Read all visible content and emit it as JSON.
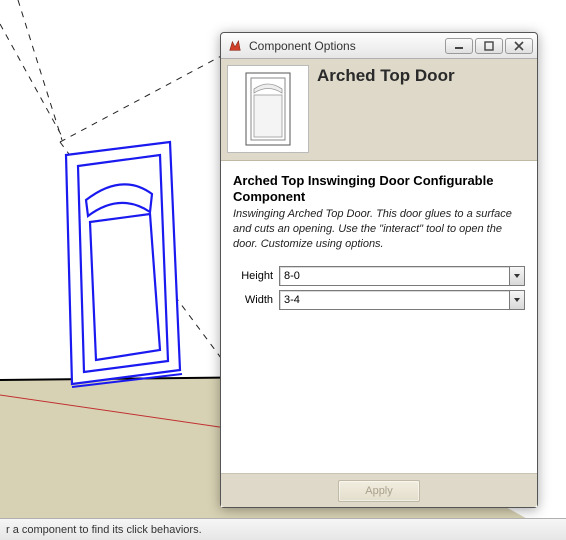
{
  "dialog": {
    "title": "Component Options",
    "component_name": "Arched Top Door",
    "subheading": "Arched Top Inswinging Door Configurable Component",
    "description": "Inswinging Arched Top Door. This door glues to a surface and cuts an opening. Use the \"interact\" tool to open the door. Customize using options.",
    "fields": {
      "height": {
        "label": "Height",
        "value": "8-0"
      },
      "width": {
        "label": "Width",
        "value": "3-4"
      }
    },
    "apply_label": "Apply"
  },
  "status_bar": {
    "text": "r a component to find its click behaviors."
  },
  "colors": {
    "door_outline": "#1a1af0",
    "header_band": "#ded9c8",
    "floor": "#d8d2b4"
  }
}
